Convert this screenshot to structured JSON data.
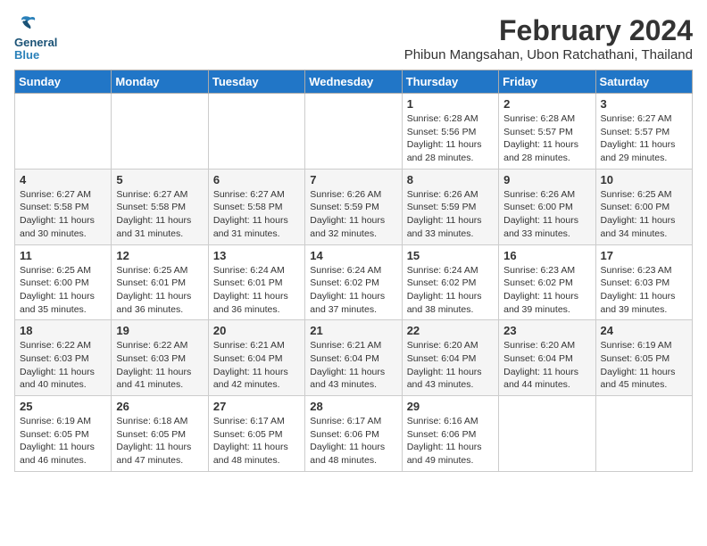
{
  "logo": {
    "line1": "General",
    "line2": "Blue"
  },
  "title": "February 2024",
  "subtitle": "Phibun Mangsahan, Ubon Ratchathani, Thailand",
  "headers": [
    "Sunday",
    "Monday",
    "Tuesday",
    "Wednesday",
    "Thursday",
    "Friday",
    "Saturday"
  ],
  "weeks": [
    [
      {
        "day": "",
        "info": ""
      },
      {
        "day": "",
        "info": ""
      },
      {
        "day": "",
        "info": ""
      },
      {
        "day": "",
        "info": ""
      },
      {
        "day": "1",
        "info": "Sunrise: 6:28 AM\nSunset: 5:56 PM\nDaylight: 11 hours\nand 28 minutes."
      },
      {
        "day": "2",
        "info": "Sunrise: 6:28 AM\nSunset: 5:57 PM\nDaylight: 11 hours\nand 28 minutes."
      },
      {
        "day": "3",
        "info": "Sunrise: 6:27 AM\nSunset: 5:57 PM\nDaylight: 11 hours\nand 29 minutes."
      }
    ],
    [
      {
        "day": "4",
        "info": "Sunrise: 6:27 AM\nSunset: 5:58 PM\nDaylight: 11 hours\nand 30 minutes."
      },
      {
        "day": "5",
        "info": "Sunrise: 6:27 AM\nSunset: 5:58 PM\nDaylight: 11 hours\nand 31 minutes."
      },
      {
        "day": "6",
        "info": "Sunrise: 6:27 AM\nSunset: 5:58 PM\nDaylight: 11 hours\nand 31 minutes."
      },
      {
        "day": "7",
        "info": "Sunrise: 6:26 AM\nSunset: 5:59 PM\nDaylight: 11 hours\nand 32 minutes."
      },
      {
        "day": "8",
        "info": "Sunrise: 6:26 AM\nSunset: 5:59 PM\nDaylight: 11 hours\nand 33 minutes."
      },
      {
        "day": "9",
        "info": "Sunrise: 6:26 AM\nSunset: 6:00 PM\nDaylight: 11 hours\nand 33 minutes."
      },
      {
        "day": "10",
        "info": "Sunrise: 6:25 AM\nSunset: 6:00 PM\nDaylight: 11 hours\nand 34 minutes."
      }
    ],
    [
      {
        "day": "11",
        "info": "Sunrise: 6:25 AM\nSunset: 6:00 PM\nDaylight: 11 hours\nand 35 minutes."
      },
      {
        "day": "12",
        "info": "Sunrise: 6:25 AM\nSunset: 6:01 PM\nDaylight: 11 hours\nand 36 minutes."
      },
      {
        "day": "13",
        "info": "Sunrise: 6:24 AM\nSunset: 6:01 PM\nDaylight: 11 hours\nand 36 minutes."
      },
      {
        "day": "14",
        "info": "Sunrise: 6:24 AM\nSunset: 6:02 PM\nDaylight: 11 hours\nand 37 minutes."
      },
      {
        "day": "15",
        "info": "Sunrise: 6:24 AM\nSunset: 6:02 PM\nDaylight: 11 hours\nand 38 minutes."
      },
      {
        "day": "16",
        "info": "Sunrise: 6:23 AM\nSunset: 6:02 PM\nDaylight: 11 hours\nand 39 minutes."
      },
      {
        "day": "17",
        "info": "Sunrise: 6:23 AM\nSunset: 6:03 PM\nDaylight: 11 hours\nand 39 minutes."
      }
    ],
    [
      {
        "day": "18",
        "info": "Sunrise: 6:22 AM\nSunset: 6:03 PM\nDaylight: 11 hours\nand 40 minutes."
      },
      {
        "day": "19",
        "info": "Sunrise: 6:22 AM\nSunset: 6:03 PM\nDaylight: 11 hours\nand 41 minutes."
      },
      {
        "day": "20",
        "info": "Sunrise: 6:21 AM\nSunset: 6:04 PM\nDaylight: 11 hours\nand 42 minutes."
      },
      {
        "day": "21",
        "info": "Sunrise: 6:21 AM\nSunset: 6:04 PM\nDaylight: 11 hours\nand 43 minutes."
      },
      {
        "day": "22",
        "info": "Sunrise: 6:20 AM\nSunset: 6:04 PM\nDaylight: 11 hours\nand 43 minutes."
      },
      {
        "day": "23",
        "info": "Sunrise: 6:20 AM\nSunset: 6:04 PM\nDaylight: 11 hours\nand 44 minutes."
      },
      {
        "day": "24",
        "info": "Sunrise: 6:19 AM\nSunset: 6:05 PM\nDaylight: 11 hours\nand 45 minutes."
      }
    ],
    [
      {
        "day": "25",
        "info": "Sunrise: 6:19 AM\nSunset: 6:05 PM\nDaylight: 11 hours\nand 46 minutes."
      },
      {
        "day": "26",
        "info": "Sunrise: 6:18 AM\nSunset: 6:05 PM\nDaylight: 11 hours\nand 47 minutes."
      },
      {
        "day": "27",
        "info": "Sunrise: 6:17 AM\nSunset: 6:05 PM\nDaylight: 11 hours\nand 48 minutes."
      },
      {
        "day": "28",
        "info": "Sunrise: 6:17 AM\nSunset: 6:06 PM\nDaylight: 11 hours\nand 48 minutes."
      },
      {
        "day": "29",
        "info": "Sunrise: 6:16 AM\nSunset: 6:06 PM\nDaylight: 11 hours\nand 49 minutes."
      },
      {
        "day": "",
        "info": ""
      },
      {
        "day": "",
        "info": ""
      }
    ]
  ]
}
